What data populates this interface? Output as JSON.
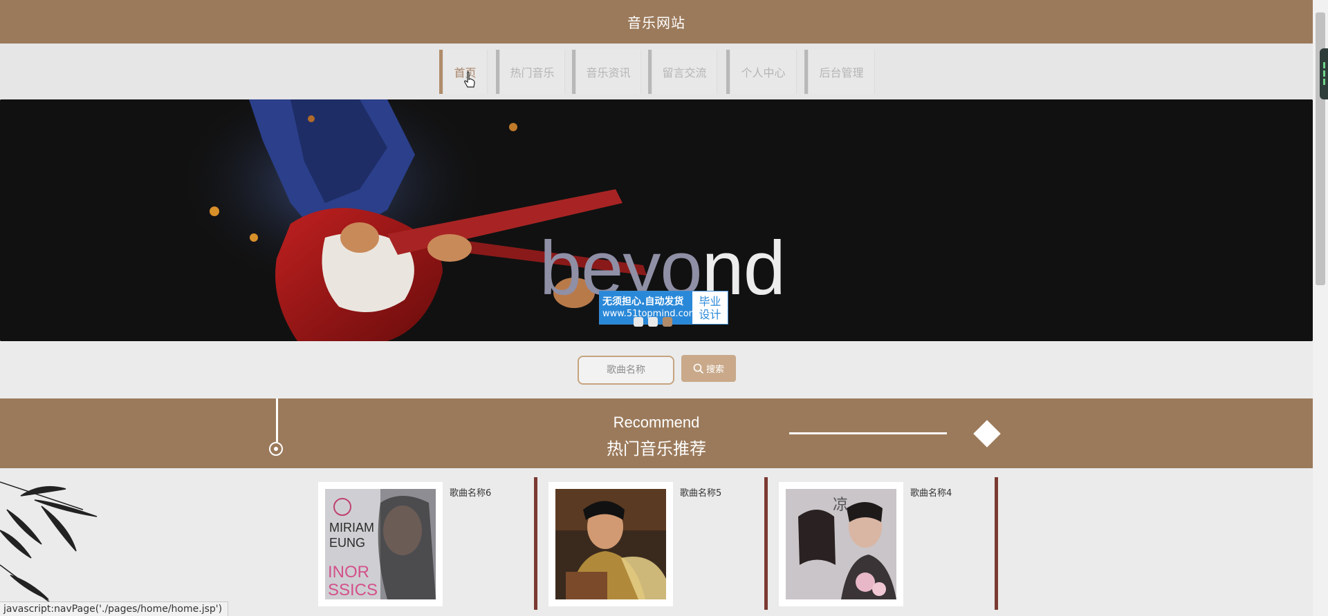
{
  "header": {
    "title": "音乐网站"
  },
  "nav": {
    "items": [
      {
        "label": "首页",
        "active": true
      },
      {
        "label": "热门音乐",
        "active": false
      },
      {
        "label": "音乐资讯",
        "active": false
      },
      {
        "label": "留言交流",
        "active": false
      },
      {
        "label": "个人中心",
        "active": false
      },
      {
        "label": "后台管理",
        "active": false
      }
    ]
  },
  "banner": {
    "title_part1": "beyo",
    "title_part2": "nd",
    "slide_count": 3,
    "active_slide": 3,
    "watermark": {
      "line1": "无须担心.自动发货",
      "line2": "www.51topmind.com",
      "right_line1": "毕业",
      "right_line2": "设计"
    }
  },
  "search": {
    "placeholder": "歌曲名称",
    "button_label": "搜索"
  },
  "recommend": {
    "title_en": "Recommend",
    "title_cn": "热门音乐推荐"
  },
  "songs": [
    {
      "name": "歌曲名称6",
      "cover": "album-cover-miriam-yeung"
    },
    {
      "name": "歌曲名称5",
      "cover": "album-cover-jay-chou"
    },
    {
      "name": "歌曲名称4",
      "cover": "album-cover-liangliang"
    }
  ],
  "status_bar": {
    "text": "javascript:navPage('./pages/home/home.jsp')"
  },
  "colors": {
    "brand": "#9b7a5b",
    "accent": "#b08c6b",
    "song_divider": "#7a3a32",
    "search_button": "#c9a98a"
  }
}
